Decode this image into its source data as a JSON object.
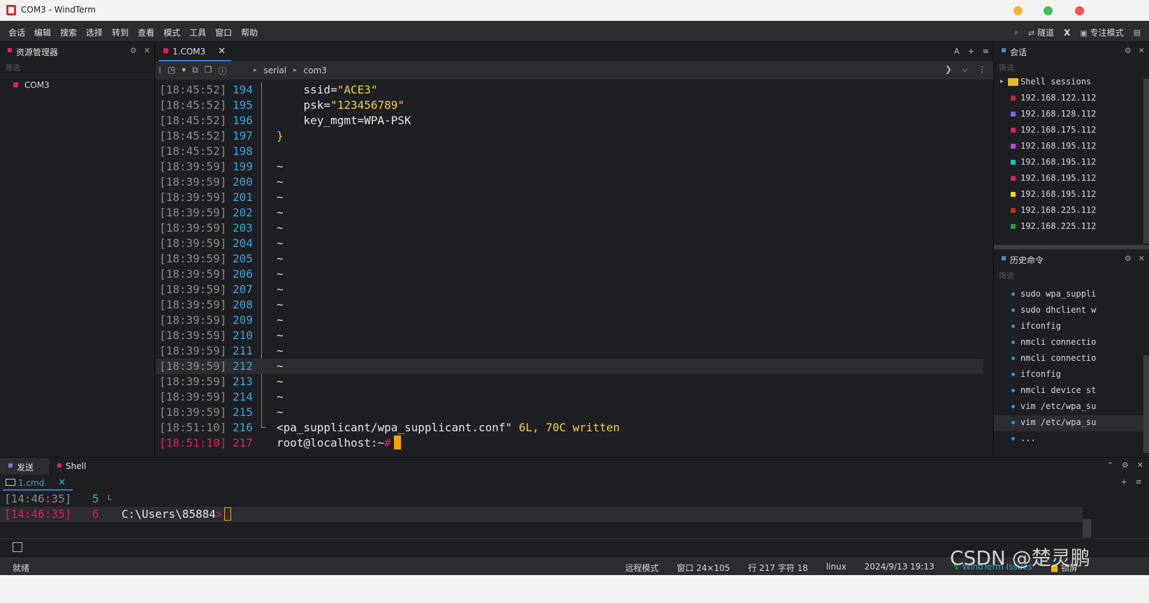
{
  "window": {
    "title": "COM3 - WindTerm"
  },
  "menu": {
    "items": [
      "会话",
      "编辑",
      "搜索",
      "选择",
      "转到",
      "查看",
      "模式",
      "工具",
      "窗口",
      "帮助"
    ],
    "tunnel": "隧道",
    "focus_mode": "专注模式",
    "x_label": "X"
  },
  "explorer": {
    "title": "资源管理器",
    "filter_placeholder": "筛选",
    "items": [
      "COM3"
    ]
  },
  "tab": {
    "label": "1.COM3"
  },
  "breadcrumb": [
    "serial",
    "com3"
  ],
  "terminal": {
    "lines": [
      {
        "ts": "[18:45:52]",
        "ln": "194",
        "indent": "    ",
        "key": "ssid",
        "val": "\"ACE3\""
      },
      {
        "ts": "[18:45:52]",
        "ln": "195",
        "indent": "    ",
        "key": "psk",
        "val": "\"123456789\""
      },
      {
        "ts": "[18:45:52]",
        "ln": "196",
        "indent": "    ",
        "key": "key_mgmt",
        "val": "WPA-PSK"
      },
      {
        "ts": "[18:45:52]",
        "ln": "197",
        "text": "}"
      },
      {
        "ts": "[18:45:52]",
        "ln": "198",
        "text": ""
      },
      {
        "ts": "[18:39:59]",
        "ln": "199",
        "text": "~"
      },
      {
        "ts": "[18:39:59]",
        "ln": "200",
        "text": "~"
      },
      {
        "ts": "[18:39:59]",
        "ln": "201",
        "text": "~"
      },
      {
        "ts": "[18:39:59]",
        "ln": "202",
        "text": "~"
      },
      {
        "ts": "[18:39:59]",
        "ln": "203",
        "text": "~"
      },
      {
        "ts": "[18:39:59]",
        "ln": "204",
        "text": "~"
      },
      {
        "ts": "[18:39:59]",
        "ln": "205",
        "text": "~"
      },
      {
        "ts": "[18:39:59]",
        "ln": "206",
        "text": "~"
      },
      {
        "ts": "[18:39:59]",
        "ln": "207",
        "text": "~"
      },
      {
        "ts": "[18:39:59]",
        "ln": "208",
        "text": "~"
      },
      {
        "ts": "[18:39:59]",
        "ln": "209",
        "text": "~"
      },
      {
        "ts": "[18:39:59]",
        "ln": "210",
        "text": "~"
      },
      {
        "ts": "[18:39:59]",
        "ln": "211",
        "text": "~"
      },
      {
        "ts": "[18:39:59]",
        "ln": "212",
        "text": "~"
      },
      {
        "ts": "[18:39:59]",
        "ln": "213",
        "text": "~"
      },
      {
        "ts": "[18:39:59]",
        "ln": "214",
        "text": "~"
      },
      {
        "ts": "[18:39:59]",
        "ln": "215",
        "text": "~"
      },
      {
        "ts": "[18:51:10]",
        "ln": "216",
        "text": "<pa_supplicant/wpa_supplicant.conf\"",
        "extra": " 6L, 70C written"
      },
      {
        "ts": "[18:51:10]",
        "ln": "217",
        "text": "root@localhost:~",
        "prompt": "#"
      }
    ]
  },
  "sessions": {
    "title": "会话",
    "filter_placeholder": "筛选",
    "folder": "Shell sessions",
    "items": [
      {
        "label": "192.168.122.112",
        "color": "#c62828"
      },
      {
        "label": "192.168.128.112",
        "color": "#7b68ee"
      },
      {
        "label": "192.168.175.112",
        "color": "#e8195e"
      },
      {
        "label": "192.168.195.112",
        "color": "#b54fd8"
      },
      {
        "label": "192.168.195.112",
        "color": "#19c3c3"
      },
      {
        "label": "192.168.195.112",
        "color": "#e8195e"
      },
      {
        "label": "192.168.195.112",
        "color": "#f5d800"
      },
      {
        "label": "192.168.225.112",
        "color": "#c62828"
      },
      {
        "label": "192.168.225.112",
        "color": "#2e9e3a"
      }
    ]
  },
  "history": {
    "title": "历史命令",
    "filter_placeholder": "筛选",
    "items": [
      "sudo wpa_suppli",
      "sudo dhclient w",
      "ifconfig",
      "nmcli connectio",
      "nmcli connectio",
      "ifconfig",
      "nmcli device st",
      "vim /etc/wpa_su",
      "vim /etc/wpa_su",
      "..."
    ]
  },
  "bottom": {
    "tabs": [
      {
        "label": "发送",
        "color": "#8a6cd8"
      },
      {
        "label": "Shell",
        "color": "#e8195e"
      }
    ],
    "subtab": "1.cmd",
    "lines": [
      {
        "ts": "[14:46:35]",
        "ln": "5",
        "text": ""
      },
      {
        "ts": "[14:46:35]",
        "ln": "6",
        "text": "C:\\Users\\85884",
        "prompt": ">"
      }
    ]
  },
  "status": {
    "ready": "就绪",
    "mode": "远程模式",
    "window_size": "窗口 24×105",
    "position": "行 217 字符 18",
    "os": "linux",
    "datetime": "2024/9/13 19:13",
    "issues": "WindTerm Issues",
    "lock": "锁屏"
  },
  "watermark": "CSDN @楚灵鹏"
}
